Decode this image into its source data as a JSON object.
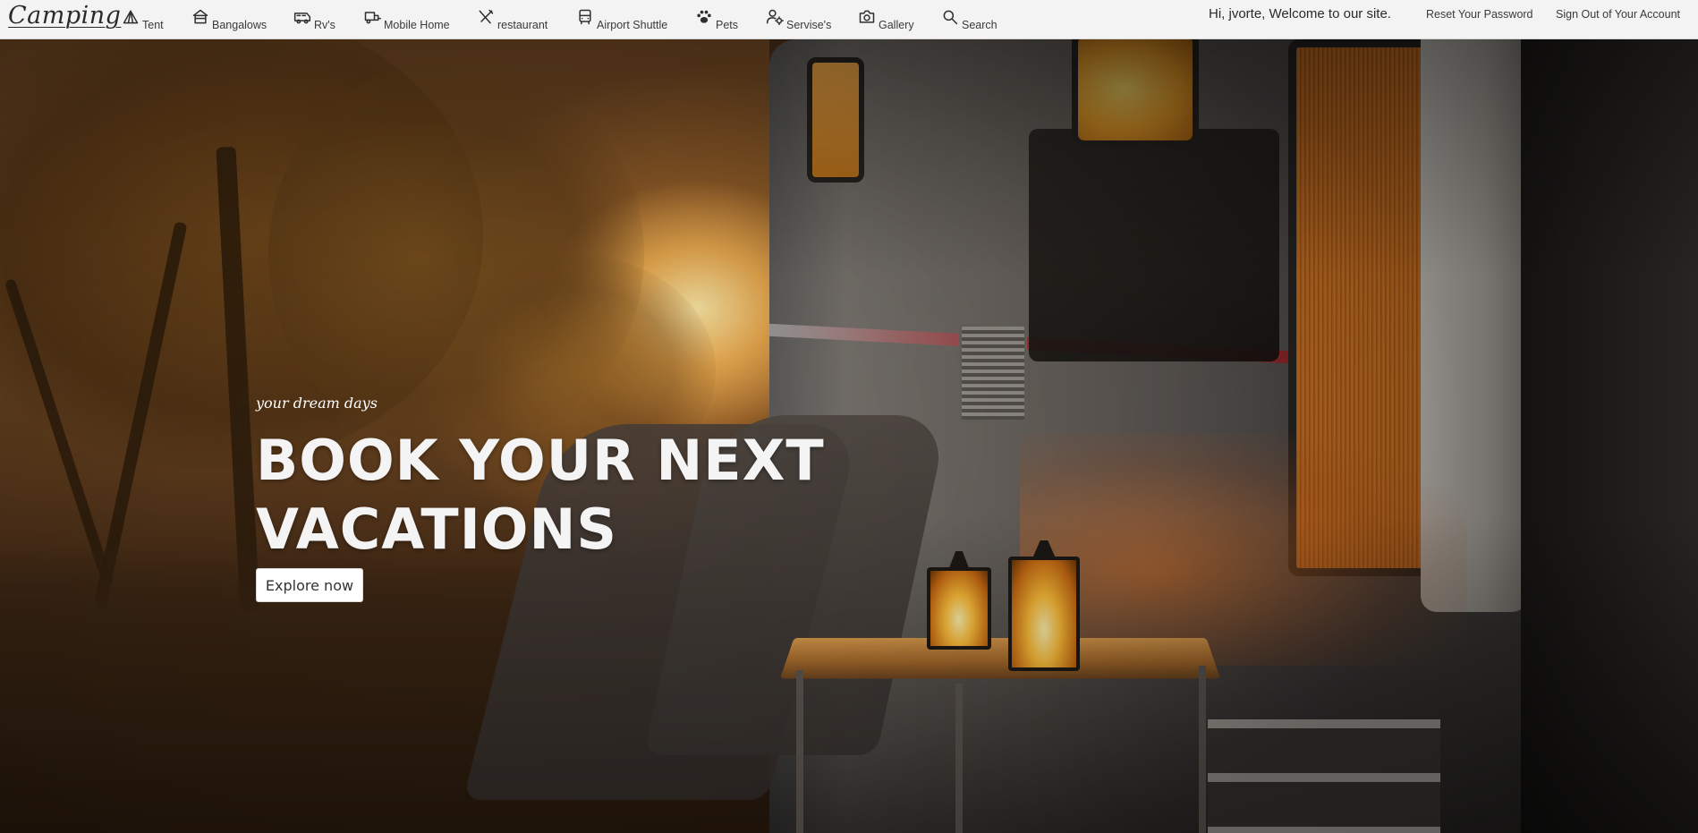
{
  "brand": {
    "name": "Camping"
  },
  "nav": {
    "items": [
      {
        "label": "Tent",
        "icon": "tent-icon"
      },
      {
        "label": "Bangalows",
        "icon": "bungalow-icon"
      },
      {
        "label": "Rv's",
        "icon": "rv-icon"
      },
      {
        "label": "Mobile Home",
        "icon": "mobile-home-icon"
      },
      {
        "label": "restaurant",
        "icon": "utensils-icon"
      },
      {
        "label": "Airport Shuttle",
        "icon": "bus-icon"
      },
      {
        "label": "Pets",
        "icon": "paw-icon"
      },
      {
        "label": "Servise's",
        "icon": "user-cog-icon"
      },
      {
        "label": "Gallery",
        "icon": "camera-icon"
      },
      {
        "label": "Search",
        "icon": "search-icon"
      }
    ]
  },
  "account": {
    "welcome": "Hi, jvorte, Welcome to our site.",
    "reset_password": "Reset Your Password",
    "sign_out": "Sign Out of Your Account"
  },
  "hero": {
    "tagline": "your dream days",
    "headline_line1": "BOOK YOUR NEXT",
    "headline_line2": "VACATIONS",
    "cta_label": "Explore now"
  },
  "colors": {
    "navbar_bg": "#f3f3f3",
    "hero_text": "#f4f4f4",
    "cta_bg": "#ffffff"
  }
}
